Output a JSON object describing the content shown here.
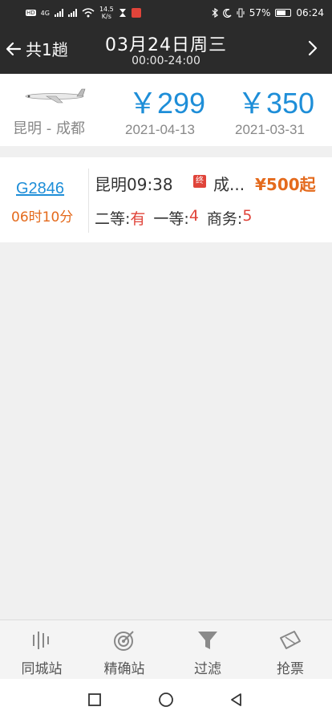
{
  "status_bar": {
    "speed_value": "14.5",
    "speed_unit": "K/s",
    "battery": "57%",
    "time": "06:24",
    "network": "4G",
    "hd": "HD"
  },
  "header": {
    "back_label": "共1趟",
    "title": "03月24日周三",
    "subtitle": "00:00-24:00",
    "icons": {
      "back": "arrow-left-icon",
      "next": "chevron-right-icon"
    }
  },
  "flight": {
    "route": "昆明 - 成都",
    "prices": [
      {
        "price": "￥299",
        "date": "2021-04-13"
      },
      {
        "price": "￥350",
        "date": "2021-03-31"
      }
    ],
    "icon": "airplane-icon"
  },
  "train": {
    "number": "G2846",
    "duration": "06时10分",
    "departure": "昆明09:38",
    "end_badge": "终",
    "arrival": "成...",
    "fare": "¥500起",
    "seats": [
      {
        "label": "二等:",
        "value": "有"
      },
      {
        "label": "一等:",
        "value": "4"
      },
      {
        "label": "商务:",
        "value": "5"
      }
    ]
  },
  "bottom_nav": [
    {
      "label": "同城站",
      "icon": "bars-icon"
    },
    {
      "label": "精确站",
      "icon": "target-icon"
    },
    {
      "label": "过滤",
      "icon": "filter-icon"
    },
    {
      "label": "抢票",
      "icon": "ticket-icon"
    }
  ],
  "colors": {
    "accent_blue": "#1e8ed8",
    "accent_orange": "#e46a1c",
    "accent_red": "#e0443a",
    "bar_dark": "#2b2b2b"
  }
}
